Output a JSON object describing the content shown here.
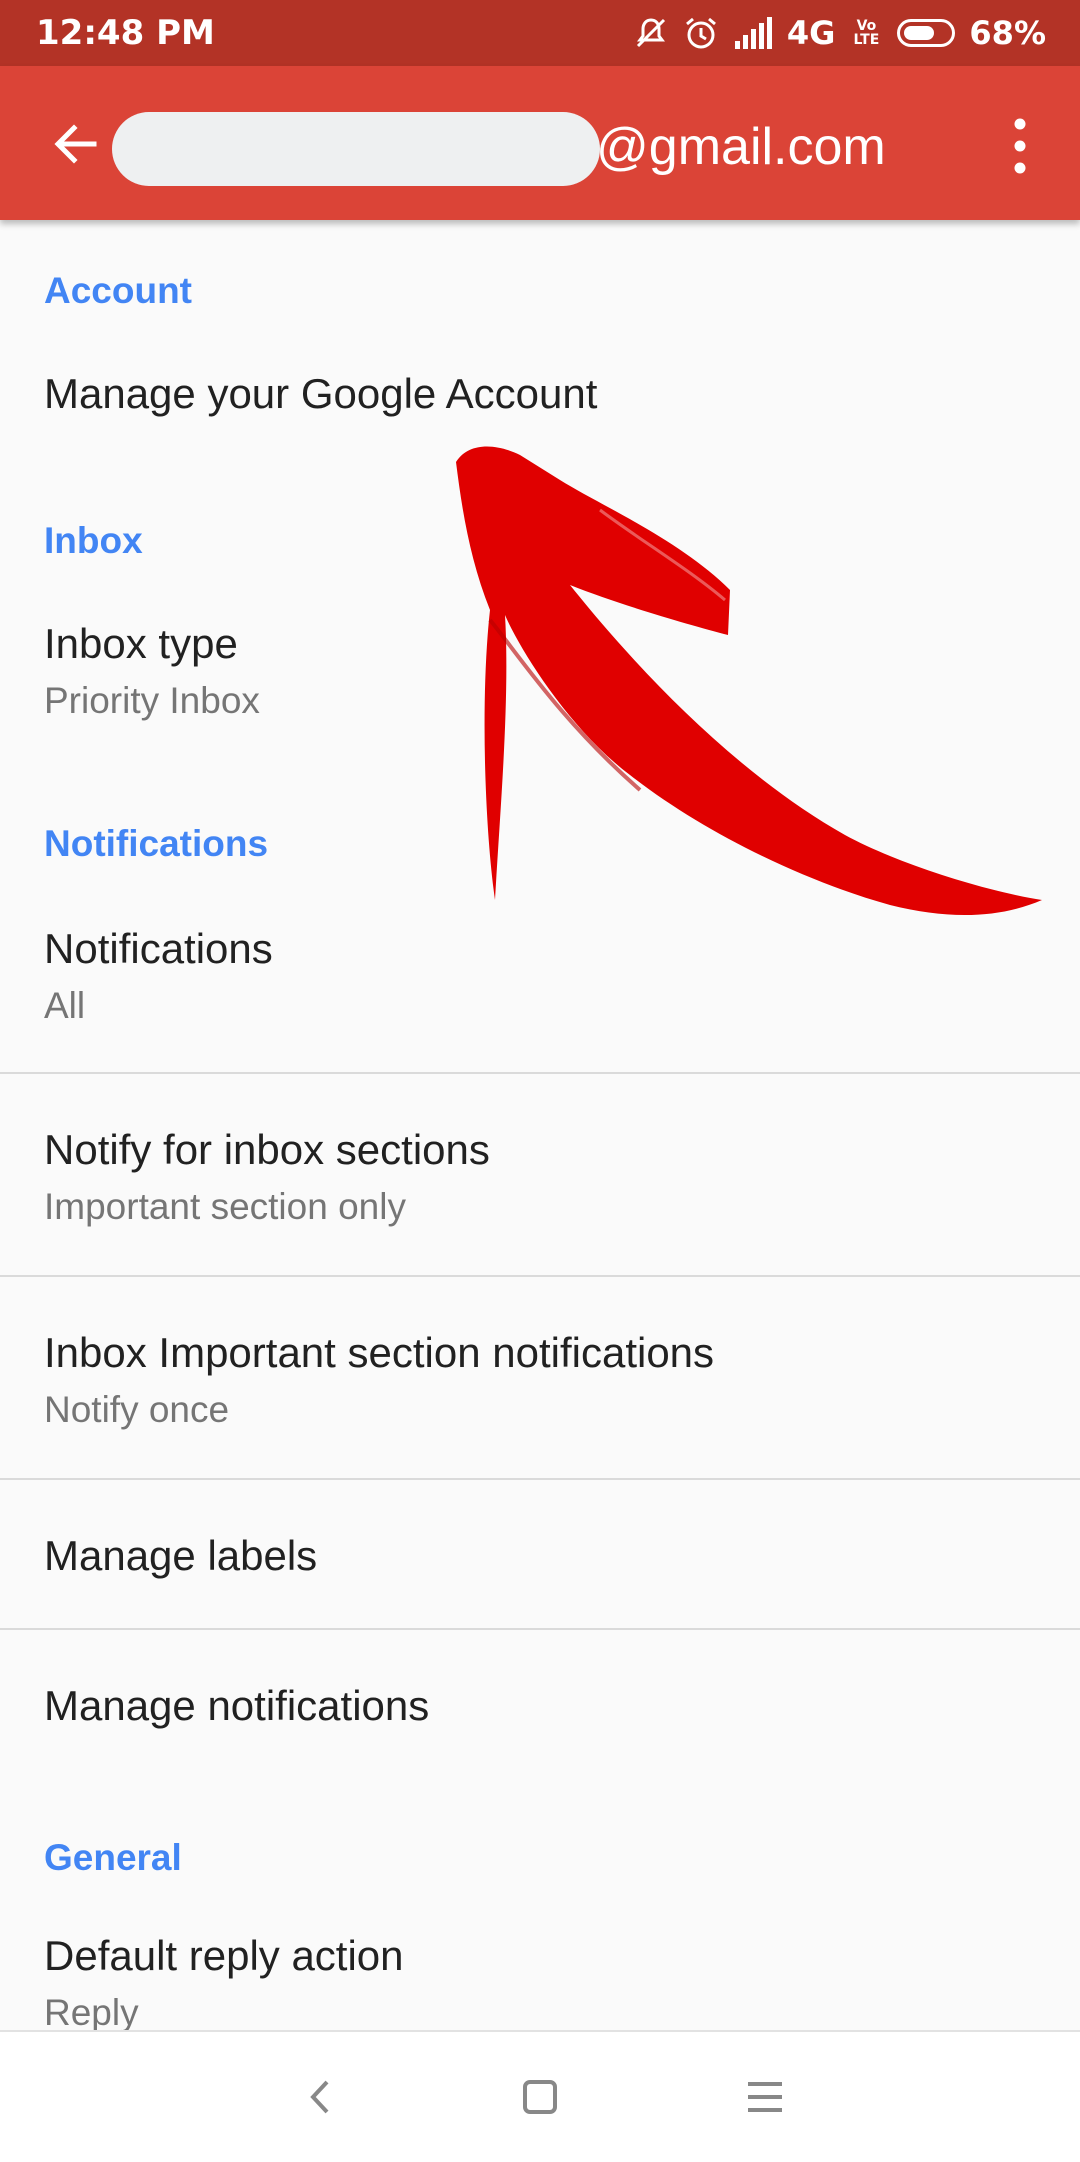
{
  "status_bar": {
    "time": "12:48 PM",
    "network": "4G",
    "volte": "Vo LTE",
    "battery": "68%",
    "icons": [
      "muted-notifications-icon",
      "alarm-icon",
      "signal-icon",
      "battery-icon"
    ]
  },
  "app_bar": {
    "email_domain": "@gmail.com",
    "back_icon": "arrow-back-icon",
    "menu_icon": "more-vert-icon"
  },
  "sections": {
    "account": {
      "header": "Account",
      "manage_account": "Manage your Google Account"
    },
    "inbox": {
      "header": "Inbox",
      "inbox_type_title": "Inbox type",
      "inbox_type_value": "Priority Inbox"
    },
    "notifications": {
      "header": "Notifications",
      "notifications_title": "Notifications",
      "notifications_value": "All",
      "notify_sections_title": "Notify for inbox sections",
      "notify_sections_value": "Important section only",
      "important_notif_title": "Inbox Important section notifications",
      "important_notif_value": "Notify once",
      "manage_labels": "Manage labels",
      "manage_notifications": "Manage notifications"
    },
    "general": {
      "header": "General",
      "reply_action_title": "Default reply action",
      "reply_action_value": "Reply"
    }
  },
  "nav_bar": {
    "icons": [
      "nav-back-icon",
      "nav-home-icon",
      "nav-recents-icon"
    ]
  },
  "colors": {
    "status_bar": "#b33326",
    "app_bar": "#db4437",
    "section_header": "#4285f4",
    "annotation_arrow": "#e00000"
  }
}
